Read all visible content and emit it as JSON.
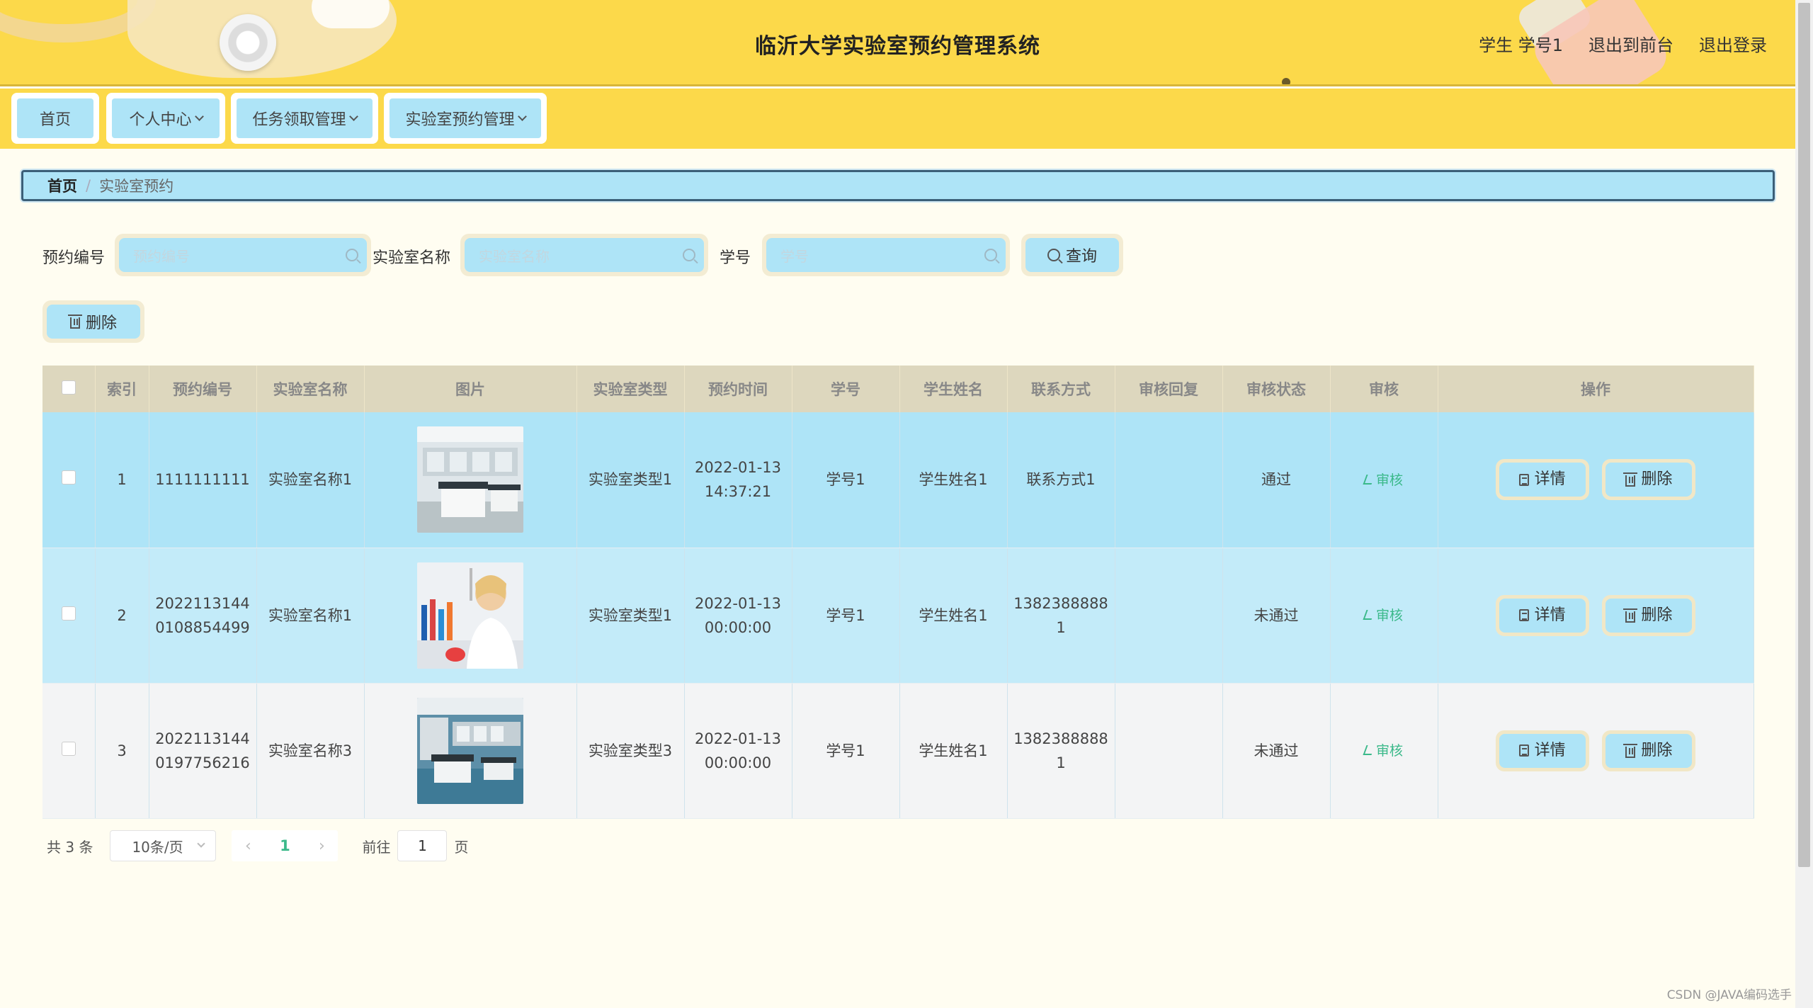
{
  "header": {
    "title": "临沂大学实验室预约管理系统",
    "user": "学生 学号1",
    "to_front": "退出到前台",
    "logout": "退出登录"
  },
  "nav": [
    {
      "label": "首页"
    },
    {
      "label": "个人中心"
    },
    {
      "label": "任务领取管理"
    },
    {
      "label": "实验室预约管理"
    }
  ],
  "breadcrumb": {
    "home": "首页",
    "sep": "/",
    "current": "实验室预约"
  },
  "search": {
    "f1_label": "预约编号",
    "f1_placeholder": "预约编号",
    "f2_label": "实验室名称",
    "f2_placeholder": "实验室名称",
    "f3_label": "学号",
    "f3_placeholder": "学号",
    "query_label": "查询"
  },
  "actions": {
    "delete_label": "删除"
  },
  "table": {
    "headers": [
      "索引",
      "预约编号",
      "实验室名称",
      "图片",
      "实验室类型",
      "预约时间",
      "学号",
      "学生姓名",
      "联系方式",
      "审核回复",
      "审核状态",
      "审核",
      "操作"
    ],
    "audit_label": "审核",
    "detail_label": "详情",
    "delete_label": "删除",
    "rows": [
      {
        "index": "1",
        "code": "1111111111",
        "lab": "实验室名称1",
        "type": "实验室类型1",
        "time": "2022-01-13 14:37:21",
        "sid": "学号1",
        "name": "学生姓名1",
        "contact": "联系方式1",
        "reply": "",
        "status": "通过"
      },
      {
        "index": "2",
        "code": "20221131440108854499",
        "lab": "实验室名称1",
        "type": "实验室类型1",
        "time": "2022-01-13 00:00:00",
        "sid": "学号1",
        "name": "学生姓名1",
        "contact": "13823888881",
        "reply": "",
        "status": "未通过"
      },
      {
        "index": "3",
        "code": "20221131440197756216",
        "lab": "实验室名称3",
        "type": "实验室类型3",
        "time": "2022-01-13 00:00:00",
        "sid": "学号1",
        "name": "学生姓名1",
        "contact": "13823888881",
        "reply": "",
        "status": "未通过"
      }
    ]
  },
  "pagination": {
    "total": "共 3 条",
    "page_size": "10条/页",
    "current": "1",
    "goto_label": "前往",
    "goto_value": "1",
    "page_suffix": "页"
  },
  "watermark": "CSDN @JAVA编码选手"
}
